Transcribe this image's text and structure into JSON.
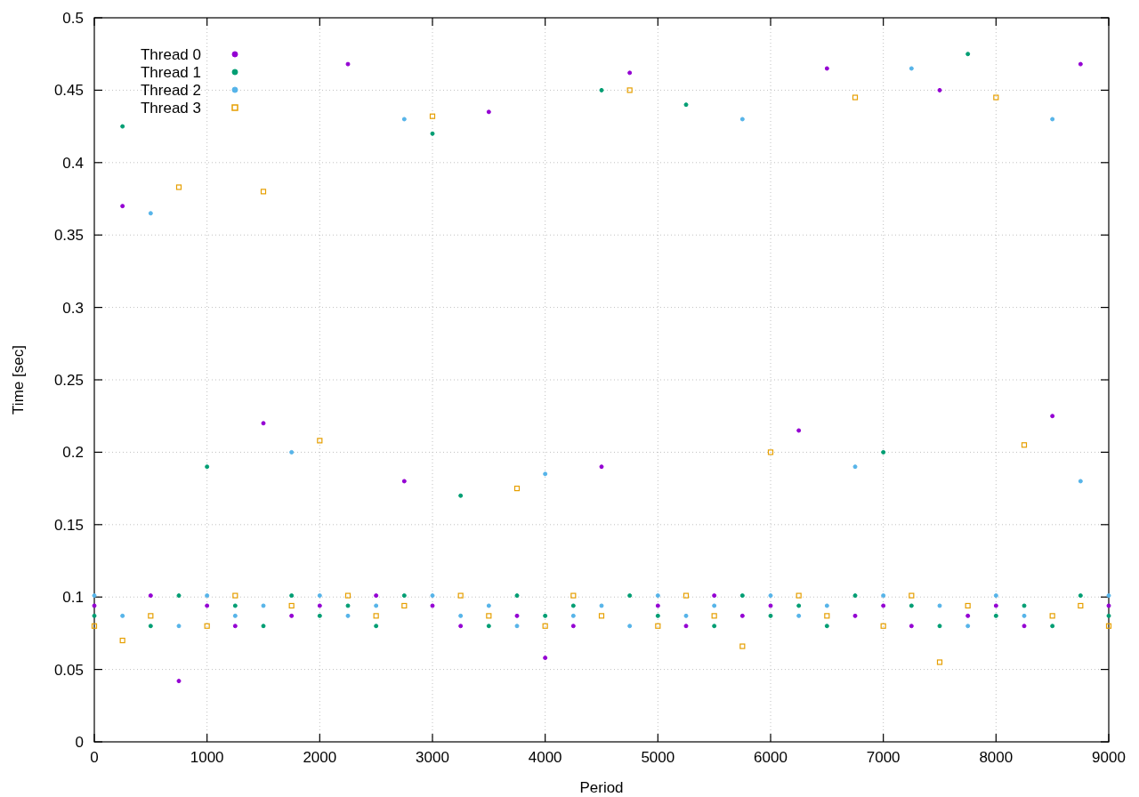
{
  "chart": {
    "chart_data": {
      "type": "scatter",
      "xlabel": "Period",
      "ylabel": "Time [sec]",
      "xlim": [
        0,
        9000
      ],
      "ylim": [
        0,
        0.5
      ],
      "x": [
        0,
        250,
        500,
        750,
        1000,
        1250,
        1500,
        1750,
        2000,
        2250,
        2500,
        2750,
        3000,
        3250,
        3500,
        3750,
        4000,
        4250,
        4500,
        4750,
        5000,
        5250,
        5500,
        5750,
        6000,
        6250,
        6500,
        6750,
        7000,
        7250,
        7500,
        7750,
        8000,
        8250,
        8500,
        8750,
        9000
      ],
      "xticks": [
        {
          "value": 0,
          "label": "0"
        },
        {
          "value": 1000,
          "label": "1000"
        },
        {
          "value": 2000,
          "label": "2000"
        },
        {
          "value": 3000,
          "label": "3000"
        },
        {
          "value": 4000,
          "label": "4000"
        },
        {
          "value": 5000,
          "label": "5000"
        },
        {
          "value": 6000,
          "label": "6000"
        },
        {
          "value": 7000,
          "label": "7000"
        },
        {
          "value": 8000,
          "label": "8000"
        },
        {
          "value": 9000,
          "label": "9000"
        }
      ],
      "yticks": [
        {
          "value": 0,
          "label": "0"
        },
        {
          "value": 0.05,
          "label": "0.05"
        },
        {
          "value": 0.1,
          "label": "0.1"
        },
        {
          "value": 0.15,
          "label": "0.15"
        },
        {
          "value": 0.2,
          "label": "0.2"
        },
        {
          "value": 0.25,
          "label": "0.25"
        },
        {
          "value": 0.3,
          "label": "0.3"
        },
        {
          "value": 0.35,
          "label": "0.35"
        },
        {
          "value": 0.4,
          "label": "0.4"
        },
        {
          "value": 0.45,
          "label": "0.45"
        },
        {
          "value": 0.5,
          "label": "0.5"
        }
      ],
      "series": [
        {
          "name": "Thread 0",
          "color": "#9400d3",
          "values": [
            0.094,
            0.37,
            0.101,
            0.042,
            0.094,
            0.08,
            0.22,
            0.087,
            0.094,
            0.468,
            0.101,
            0.18,
            0.094,
            0.08,
            0.435,
            0.087,
            0.058,
            0.08,
            0.19,
            0.462,
            0.094,
            0.08,
            0.101,
            0.087,
            0.094,
            0.215,
            0.465,
            0.087,
            0.094,
            0.08,
            0.45,
            0.087,
            0.094,
            0.08,
            0.225,
            0.468,
            0.094
          ]
        },
        {
          "name": "Thread 1",
          "color": "#009e73",
          "values": [
            0.087,
            0.425,
            0.08,
            0.101,
            0.19,
            0.094,
            0.08,
            0.101,
            0.087,
            0.094,
            0.08,
            0.101,
            0.42,
            0.17,
            0.08,
            0.101,
            0.087,
            0.094,
            0.45,
            0.101,
            0.087,
            0.44,
            0.08,
            0.101,
            0.087,
            0.094,
            0.08,
            0.101,
            0.2,
            0.094,
            0.08,
            0.475,
            0.087,
            0.094,
            0.08,
            0.101,
            0.087
          ]
        },
        {
          "name": "Thread 2",
          "color": "#56b4e9",
          "values": [
            0.101,
            0.087,
            0.365,
            0.08,
            0.101,
            0.087,
            0.094,
            0.2,
            0.101,
            0.087,
            0.094,
            0.43,
            0.101,
            0.087,
            0.094,
            0.08,
            0.185,
            0.087,
            0.094,
            0.08,
            0.101,
            0.087,
            0.094,
            0.43,
            0.101,
            0.087,
            0.094,
            0.19,
            0.101,
            0.465,
            0.094,
            0.08,
            0.101,
            0.087,
            0.43,
            0.18,
            0.101
          ]
        },
        {
          "name": "Thread 3",
          "color": "#e69f00",
          "values": [
            0.08,
            0.07,
            0.087,
            0.383,
            0.08,
            0.101,
            0.38,
            0.094,
            0.208,
            0.101,
            0.087,
            0.094,
            0.432,
            0.101,
            0.087,
            0.175,
            0.08,
            0.101,
            0.087,
            0.45,
            0.08,
            0.101,
            0.087,
            0.066,
            0.2,
            0.101,
            0.087,
            0.445,
            0.08,
            0.101,
            0.055,
            0.094,
            0.445,
            0.205,
            0.087,
            0.094,
            0.08
          ]
        }
      ],
      "grid": true,
      "legend": "top-left"
    }
  }
}
